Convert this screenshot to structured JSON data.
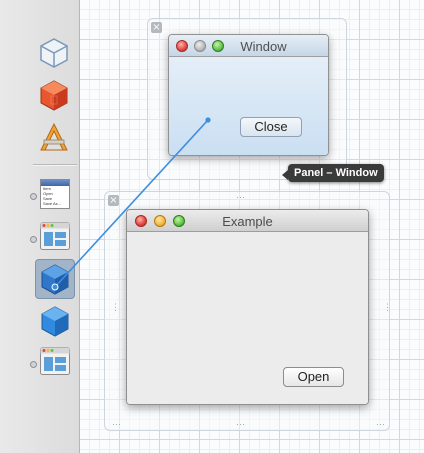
{
  "library": {
    "items": [
      {
        "icon": "object-cube-icon",
        "has_disclosure": false
      },
      {
        "icon": "red-3d-box-icon",
        "has_disclosure": false
      },
      {
        "icon": "pencil-ruler-icon",
        "has_disclosure": false
      },
      {
        "icon": "menu-icon",
        "has_disclosure": true
      },
      {
        "icon": "window-icon",
        "has_disclosure": true
      },
      {
        "icon": "blue-cube-icon",
        "has_disclosure": false,
        "selected": true
      },
      {
        "icon": "blue-cube-icon",
        "has_disclosure": false
      },
      {
        "icon": "window-icon",
        "has_disclosure": true
      }
    ],
    "menu_icon_lines": [
      "Item",
      "Open",
      "Save",
      "Save As..."
    ]
  },
  "panel_window": {
    "title": "Window",
    "close_button": "Close",
    "tooltip": "Panel – Window"
  },
  "example_window": {
    "title": "Example",
    "open_button": "Open"
  },
  "colors": {
    "connection_line": "#3d8ee0",
    "tooltip_bg": "#3a3a3a",
    "selection": "#a2b4c7"
  }
}
